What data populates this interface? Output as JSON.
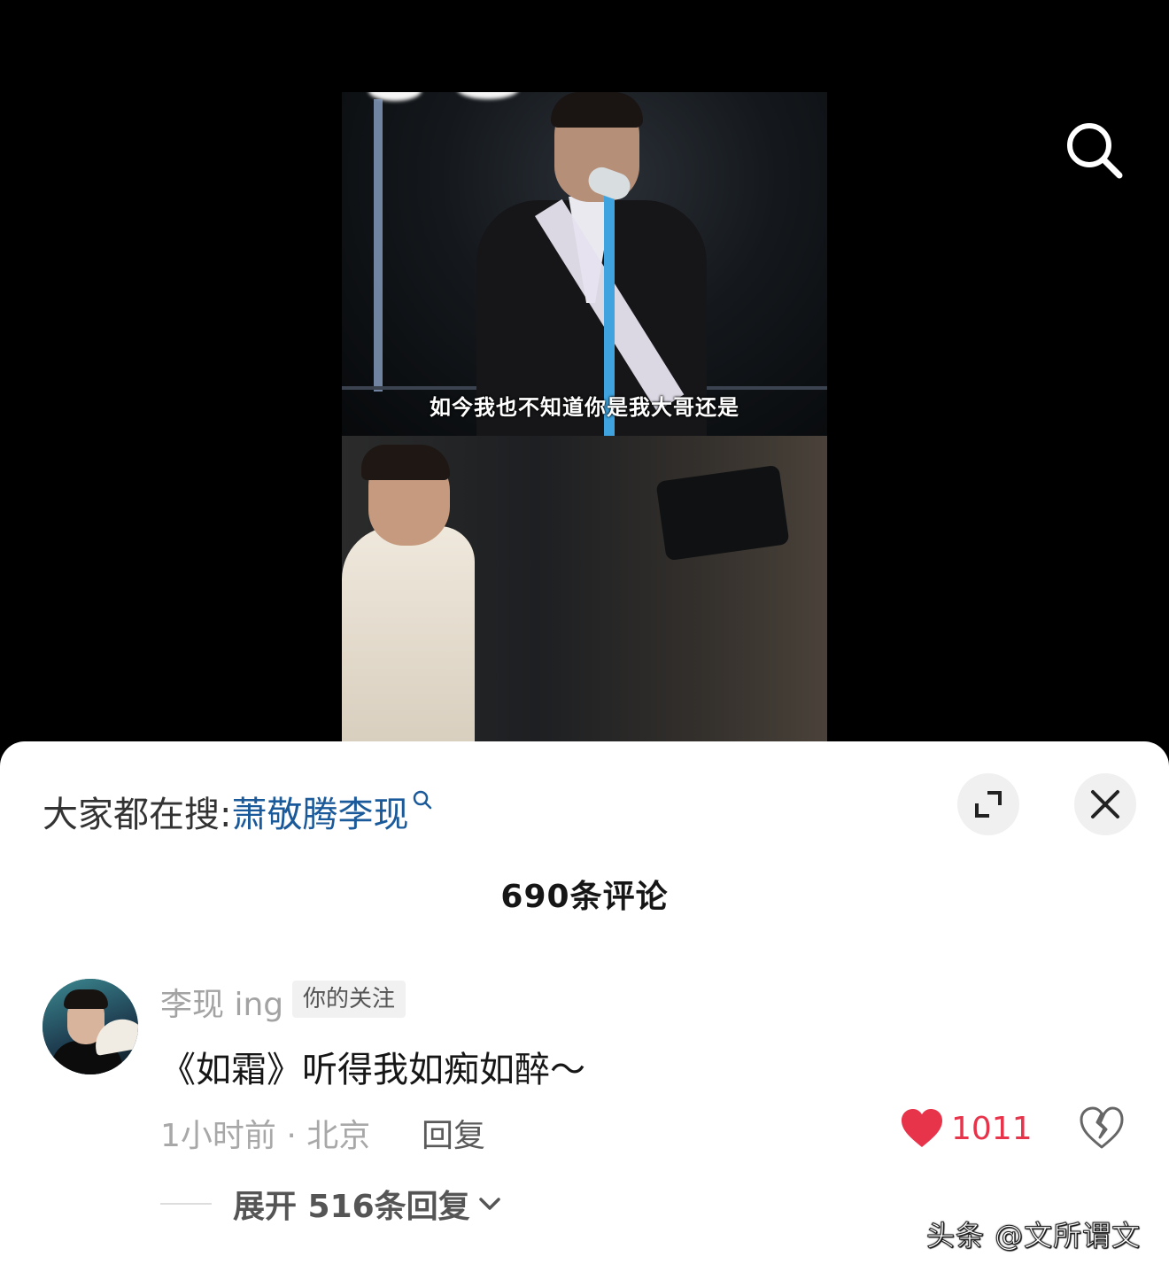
{
  "video": {
    "subtitle": "如今我也不知道你是我大哥还是"
  },
  "sheet": {
    "hot_search_prefix": "大家都在搜:",
    "hot_search_keyword": "萧敬腾李现",
    "comment_count_label": "690条评论"
  },
  "comment": {
    "username": "李现 ing",
    "badge": "你的关注",
    "text": "《如霜》听得我如痴如醉～",
    "meta": "1小时前 · 北京",
    "reply_label": "回复",
    "like_count": "1011",
    "expand_label": "展开 516条回复"
  },
  "watermark": "头条 @文所谓文",
  "colors": {
    "keyword": "#1b5a9a",
    "like": "#e8344b"
  },
  "icons": {
    "search": "search-icon",
    "expand": "expand-icon",
    "close": "close-icon",
    "heart": "heart-icon",
    "dislike": "broken-heart-icon",
    "chevron": "chevron-down-icon"
  }
}
